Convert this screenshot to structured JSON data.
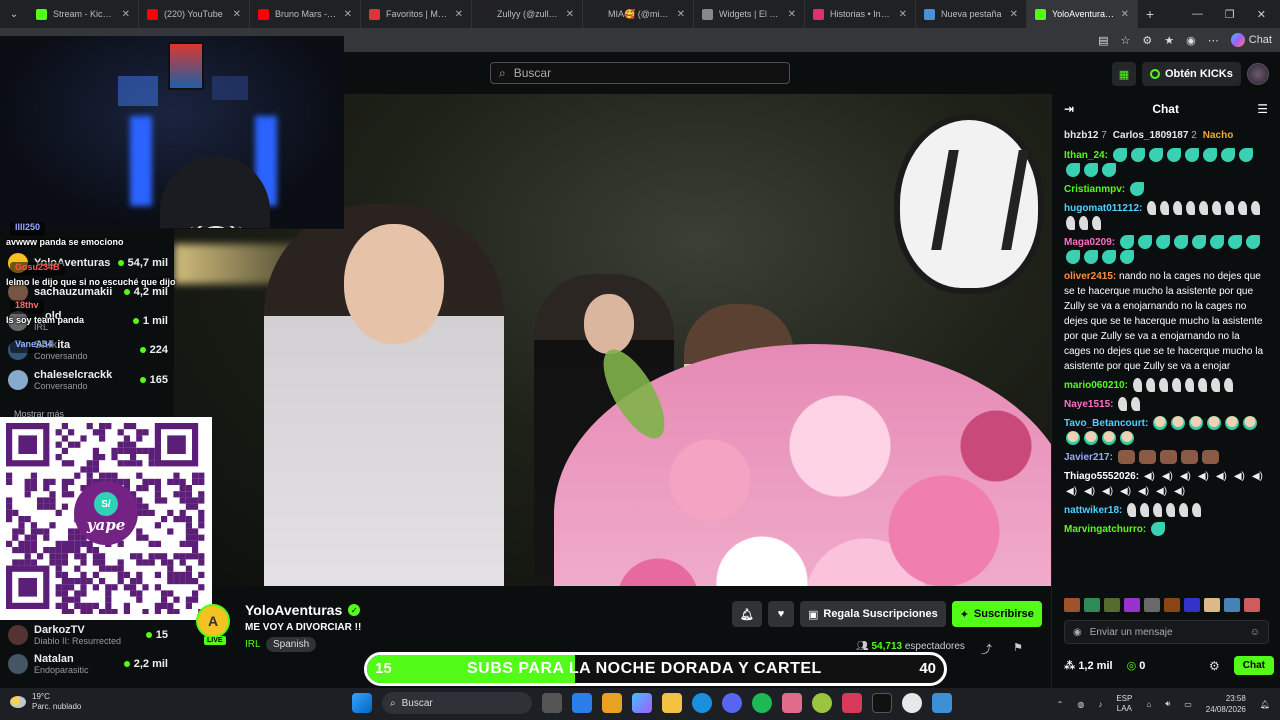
{
  "browser": {
    "tabs": [
      {
        "title": "Stream - Kick Dashb",
        "color": "#53fc18"
      },
      {
        "title": "(220) YouTube",
        "color": "#ff0000"
      },
      {
        "title": "Bruno Mars - Talking",
        "color": "#ff0000"
      },
      {
        "title": "Favoritos | Myinstan",
        "color": "#e0323b"
      },
      {
        "title": "Zullyy (@zullyy_cs) |",
        "color": "#222222"
      },
      {
        "title": "MIA🥰 (@mia.3s) |",
        "color": "#222222"
      },
      {
        "title": "Widgets | El mejor s",
        "color": "#888888"
      },
      {
        "title": "Historias • Instagram",
        "color": "#e1306c"
      },
      {
        "title": "Nueva pestaña",
        "color": "#4a90d9"
      },
      {
        "title": "YoloAventuras S",
        "color": "#53fc18"
      }
    ],
    "copilot_label": "Chat"
  },
  "site": {
    "search_placeholder": "Buscar",
    "kicks_label": "Obtén KICKs"
  },
  "sidebar": {
    "items": [
      {
        "name": "YoloAventuras",
        "sub": "",
        "count": "54,7 mil",
        "color": "#f4c221"
      },
      {
        "name": "sachauzumakii",
        "sub": "",
        "count": "4,2 mil",
        "color": "#775544"
      },
      {
        "name": "…old",
        "sub": "IRL",
        "count": "1 mil",
        "color": "#666666"
      },
      {
        "name": "Shikita",
        "sub": "Conversando",
        "count": "224",
        "color": "#335577"
      },
      {
        "name": "chaleselcrackk",
        "sub": "Conversando",
        "count": "165",
        "color": "#88aacc"
      }
    ],
    "show_more": "Mostrar más",
    "bottom_items": [
      {
        "name": "DarkozTV",
        "sub": "Diablo II: Resurrected",
        "count": "15",
        "color": "#553333"
      },
      {
        "name": "Natalan",
        "sub": "Endoparasitic",
        "count": "2,2 mil",
        "color": "#445566"
      }
    ]
  },
  "overlay_chat": [
    {
      "user": "llll250",
      "user_color": "#9aa9ff",
      "text": "avwww panda se emociono"
    },
    {
      "user": "Gosu234B",
      "user_color": "#ff5252",
      "text": "lelmo le dijo que si no escuché que dijo"
    },
    {
      "user": "18thv",
      "user_color": "#ff6a6a",
      "text": "Is soy team panda"
    },
    {
      "user": "VaneA34",
      "user_color": "#8fb0ff",
      "text": ""
    }
  ],
  "qr": {
    "brand": "yape",
    "symbol": "S/"
  },
  "channel": {
    "name": "YoloAventuras",
    "title": "ME VOY A DIVORCIAR !!",
    "category": "IRL",
    "language": "Spanish",
    "live": "LIVE",
    "viewers": "54,713",
    "viewers_label": "espectadores",
    "gift_label": "Regala Suscripciones",
    "subscribe_label": "Suscribirse"
  },
  "goal": {
    "start": "15",
    "end": "40",
    "label": "SUBS PARA LA NOCHE DORADA Y CARTEL",
    "progress": 0.36
  },
  "chat": {
    "title": "Chat",
    "top_gifters": [
      {
        "name": "bhzb12",
        "count": "7",
        "color": "#e8e8e8"
      },
      {
        "name": "Carlos_1809187",
        "count": "2",
        "color": "#e8e8e8"
      },
      {
        "name": "Nacho",
        "count": "",
        "color": "#f0a830"
      }
    ],
    "messages": [
      {
        "user": "Ithan_24:",
        "color": "#53fc18",
        "text": "",
        "emote": "mint",
        "n": 11
      },
      {
        "user": "Cristianmpv:",
        "color": "#53fc18",
        "text": "",
        "emote": "mint",
        "n": 1
      },
      {
        "user": "hugomat011212:",
        "color": "#4fd1ff",
        "text": "",
        "emote": "white",
        "n": 12
      },
      {
        "user": "Maga0209:",
        "color": "#ff6ec7",
        "text": "",
        "emote": "mint",
        "n": 12
      },
      {
        "user": "oliver2415:",
        "color": "#ff8c42",
        "text": "nando no la cages no dejes que se te hacerque mucho la asistente por que Zully se va a enojarnando no la cages no dejes que se te hacerque mucho la asistente por que Zully se va a enojarnando no la cages no dejes que se te hacerque mucho la asistente por que Zully se va a enojar",
        "emote": "",
        "n": 0
      },
      {
        "user": "mario060210:",
        "color": "#53fc18",
        "text": "",
        "emote": "white",
        "n": 8
      },
      {
        "user": "Naye1515:",
        "color": "#ff6ec7",
        "text": "",
        "emote": "white",
        "n": 2
      },
      {
        "user": "Tavo_Betancourt:",
        "color": "#4fd1ff",
        "text": "",
        "emote": "face",
        "n": 10
      },
      {
        "user": "Javier217:",
        "color": "#9aa9ff",
        "text": "",
        "emote": "brown",
        "n": 5
      },
      {
        "user": "Thiago5552026:",
        "color": "#ffffff",
        "text": "",
        "emote": "speaker",
        "n": 14
      },
      {
        "user": "nattwiker18:",
        "color": "#4fd1ff",
        "text": "",
        "emote": "white",
        "n": 6
      },
      {
        "user": "Marvingatchurro:",
        "color": "#53fc18",
        "text": "",
        "emote": "mint",
        "n": 1
      }
    ],
    "input_placeholder": "Enviar un mensaje",
    "points": "1,2 mil",
    "kicks": "0",
    "send_label": "Chat"
  },
  "taskbar": {
    "temp": "19°C",
    "weather": "Parc. nublado",
    "search": "Buscar",
    "lang1": "ESP",
    "lang2": "LAA",
    "time": "23:58",
    "date": "24/08/2026"
  }
}
